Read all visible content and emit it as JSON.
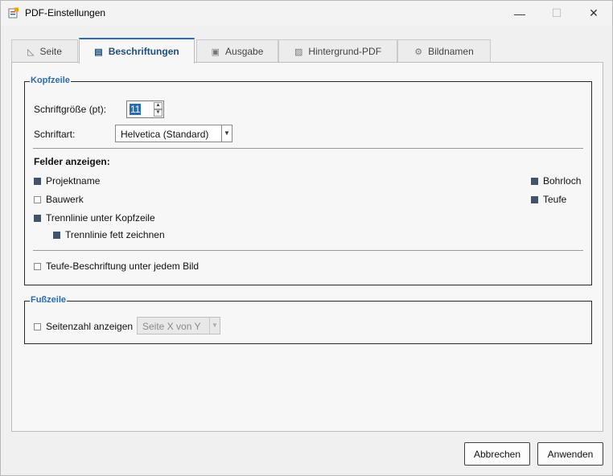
{
  "window": {
    "title": "PDF-Einstellungen",
    "minimize": "—",
    "maximize": "☐",
    "close": "✕"
  },
  "tabs": [
    {
      "label": "Seite",
      "icon": "page-icon",
      "glyph": "◺",
      "active": false
    },
    {
      "label": "Beschriftungen",
      "icon": "label-icon",
      "glyph": "▤",
      "active": true
    },
    {
      "label": "Ausgabe",
      "icon": "save-icon",
      "glyph": "▣",
      "active": false
    },
    {
      "label": "Hintergrund-PDF",
      "icon": "image-icon",
      "glyph": "▨",
      "active": false
    },
    {
      "label": "Bildnamen",
      "icon": "gear-icon",
      "glyph": "⚙",
      "active": false
    }
  ],
  "header_group": {
    "legend": "Kopfzeile",
    "font_size_label": "Schriftgröße (pt):",
    "font_size_value": "11",
    "font_label": "Schriftart:",
    "font_value": "Helvetica (Standard)",
    "fields_heading": "Felder anzeigen:",
    "checkboxes": {
      "projektname": {
        "label": "Projektname",
        "checked": true
      },
      "bauwerk": {
        "label": "Bauwerk",
        "checked": false
      },
      "trennlinie": {
        "label": "Trennlinie unter Kopfzeile",
        "checked": true
      },
      "trennlinie_fett": {
        "label": "Trennlinie fett zeichnen",
        "checked": true
      },
      "bohrloch": {
        "label": "Bohrloch",
        "checked": true
      },
      "teufe": {
        "label": "Teufe",
        "checked": true
      },
      "teufe_beschriftung": {
        "label": "Teufe-Beschriftung unter jedem Bild",
        "checked": false
      }
    }
  },
  "footer_group": {
    "legend": "Fußzeile",
    "page_number_label": "Seitenzahl anzeigen",
    "page_number_checked": false,
    "page_format_value": "Seite X von Y"
  },
  "buttons": {
    "cancel": "Abbrechen",
    "apply": "Anwenden"
  },
  "colors": {
    "accent": "#2b6cb0",
    "checkbox_checked": "#41546a"
  }
}
